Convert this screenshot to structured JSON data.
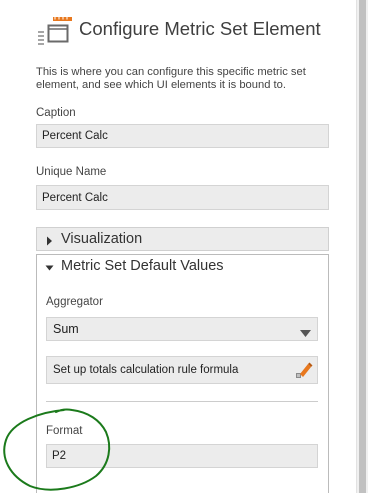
{
  "panel": {
    "title": "Configure Metric Set Element",
    "description": "This is where you can configure this specific metric set element, and see which UI elements it is bound to."
  },
  "caption": {
    "label": "Caption",
    "value": "Percent Calc"
  },
  "unique_name": {
    "label": "Unique Name",
    "value": "Percent Calc"
  },
  "sections": {
    "visualization": {
      "label": "Visualization",
      "expanded": false
    },
    "defaults": {
      "label": "Metric Set Default Values",
      "expanded": true
    }
  },
  "aggregator": {
    "label": "Aggregator",
    "selected": "Sum"
  },
  "totals_button": {
    "label": "Set up totals calculation rule formula"
  },
  "format": {
    "label": "Format",
    "value": "P2"
  },
  "colors": {
    "field_bg": "#ececec",
    "icon_orange": "#e8781e",
    "annotation_green": "#1b7a1b"
  }
}
